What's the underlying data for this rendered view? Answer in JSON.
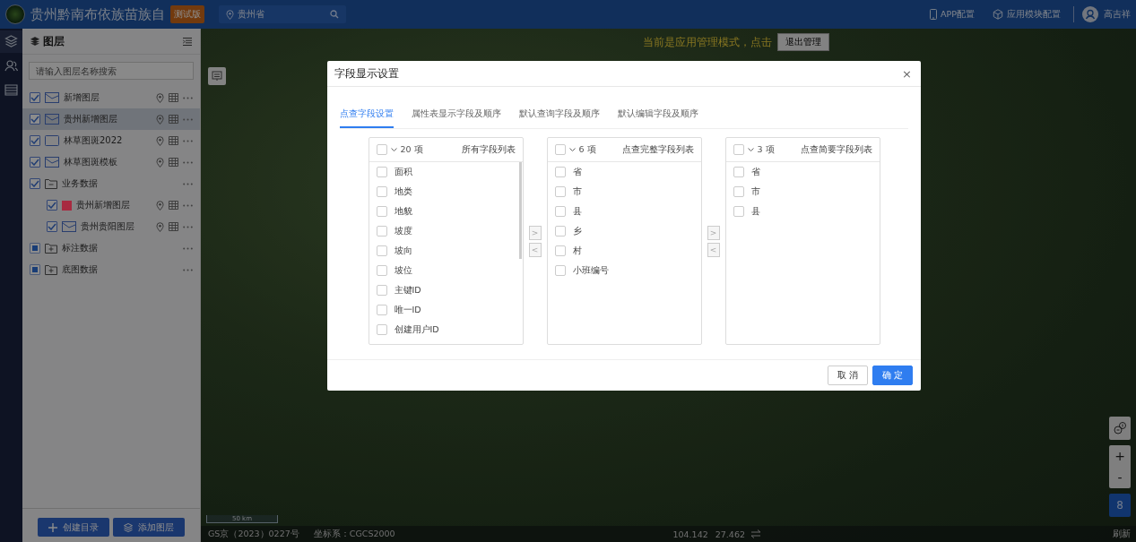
{
  "header": {
    "title": "贵州黔南布依族苗族自",
    "badge": "测试版",
    "location": {
      "value": "贵州省"
    },
    "links": [
      {
        "label": "APP配置",
        "kind": "phone"
      },
      {
        "label": "应用模块配置",
        "kind": "cube"
      }
    ],
    "user": "高吉祥"
  },
  "layer_panel": {
    "title": "图层",
    "search": {
      "placeholder": "请输入图层名称搜索"
    },
    "layers": [
      {
        "name": "新增图层",
        "kind": "polygon",
        "checked": true,
        "partial": false,
        "selected": false
      },
      {
        "name": "贵州新增图层",
        "kind": "polygon",
        "checked": true,
        "partial": false,
        "selected": true
      },
      {
        "name": "林草图斑2022",
        "kind": "rect",
        "checked": true,
        "partial": false,
        "selected": false
      },
      {
        "name": "林草图斑模板",
        "kind": "polygon",
        "checked": true,
        "partial": false,
        "selected": false
      },
      {
        "name": "业务数据",
        "kind": "folder",
        "checked": true,
        "partial": false,
        "selected": false,
        "expanded": true,
        "children": [
          {
            "name": "贵州新增图层",
            "kind": "fill",
            "color": "#a82a40",
            "checked": true,
            "partial": false,
            "selected": false
          },
          {
            "name": "贵州贵阳图层",
            "kind": "polygon",
            "checked": true,
            "partial": false,
            "selected": false
          }
        ]
      },
      {
        "name": "标注数据",
        "kind": "folder",
        "checked": false,
        "partial": true,
        "selected": false,
        "expanded": false
      },
      {
        "name": "底图数据",
        "kind": "folder",
        "checked": false,
        "partial": true,
        "selected": false,
        "expanded": false
      }
    ],
    "buttons": [
      {
        "label": "创建目录",
        "kind": "plus"
      },
      {
        "label": "添加图层",
        "kind": "layers"
      }
    ]
  },
  "map": {
    "banner": "当前是应用管理模式，点击",
    "banner_button": "退出管理",
    "scale": "50 km",
    "approval": "GS京（2023）0227号",
    "crs": "坐标系：CGCS2000",
    "lon": "104.142",
    "lat": "27.462",
    "refresh": "刷新",
    "zoom_in": "+",
    "zoom_out": "-",
    "level": "8"
  },
  "dialog": {
    "title": "字段显示设置",
    "close": "×",
    "tabs": [
      {
        "label": "点查字段设置",
        "selected": true
      },
      {
        "label": "属性表显示字段及顺序",
        "selected": false
      },
      {
        "label": "默认查询字段及顺序",
        "selected": false
      },
      {
        "label": "默认编辑字段及顺序",
        "selected": false
      }
    ],
    "lists": [
      {
        "count": "20 项",
        "title": "所有字段列表",
        "scroll": true,
        "all_checked": false,
        "items": [
          {
            "label": "面积",
            "checked": false
          },
          {
            "label": "地类",
            "checked": false
          },
          {
            "label": "地貌",
            "checked": false
          },
          {
            "label": "坡度",
            "checked": false
          },
          {
            "label": "坡向",
            "checked": false
          },
          {
            "label": "坡位",
            "checked": false
          },
          {
            "label": "主键ID",
            "checked": false
          },
          {
            "label": "唯一ID",
            "checked": false
          },
          {
            "label": "创建用户ID",
            "checked": false
          }
        ]
      },
      {
        "count": "6 项",
        "title": "点查完整字段列表",
        "scroll": false,
        "all_checked": false,
        "items": [
          {
            "label": "省",
            "checked": false
          },
          {
            "label": "市",
            "checked": false
          },
          {
            "label": "县",
            "checked": false
          },
          {
            "label": "乡",
            "checked": false
          },
          {
            "label": "村",
            "checked": false
          },
          {
            "label": "小班编号",
            "checked": false
          }
        ]
      },
      {
        "count": "3 项",
        "title": "点查简要字段列表",
        "scroll": false,
        "all_checked": false,
        "items": [
          {
            "label": "省",
            "checked": false
          },
          {
            "label": "市",
            "checked": false
          },
          {
            "label": "县",
            "checked": false
          }
        ]
      }
    ],
    "transfers": [
      {
        "right": ">",
        "left": "<",
        "disabled": true
      },
      {
        "right": ">",
        "left": "<",
        "disabled": true
      }
    ],
    "buttons": [
      {
        "label": "取 消",
        "primary": false
      },
      {
        "label": "确 定",
        "primary": true
      }
    ]
  }
}
